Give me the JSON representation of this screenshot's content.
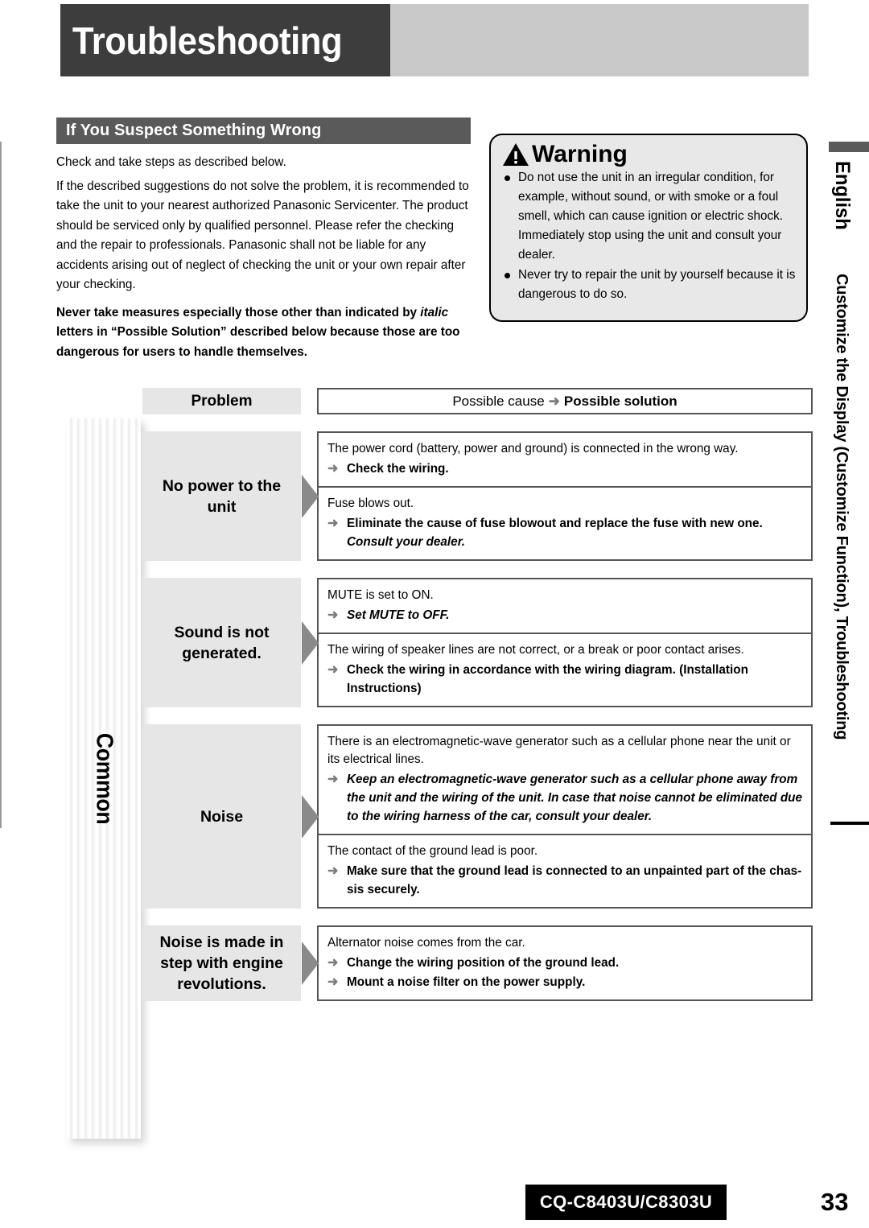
{
  "header": {
    "title": "Troubleshooting"
  },
  "section": {
    "heading": "If You Suspect Something Wrong",
    "paragraphs": [
      "Check and take steps as described below.",
      "If the described suggestions do not solve the problem, it is recommended to take the unit to your nearest authorized Panasonic Servicenter. The product should be serviced only by qualified personnel. Please refer the checking and the repair to professionals. Panasonic shall not be liable for any accidents arising out of neglect of checking the unit or your own repair after your checking."
    ],
    "bold_note_part1": "Never take measures especially those other than indicated by ",
    "bold_note_italic": "italic",
    "bold_note_part2": " letters in “Possible Solution” described below because those are too dangerous for users to handle themselves."
  },
  "warning": {
    "title": "Warning",
    "icon": "warning-triangle-icon",
    "items": [
      "Do not use the unit in an irregular condition, for example, without sound, or with smoke or a foul smell, which can cause ignition or electric shock. Immediately stop using the unit and consult your dealer.",
      "Never try to repair the unit by yourself because it is dangerous to do so."
    ]
  },
  "sidebar": {
    "language": "English",
    "chapter": "Customize the Display (Customize Function), Troubleshooting"
  },
  "section_tab": {
    "label": "Common"
  },
  "table": {
    "header": {
      "problem": "Problem",
      "cause_label": "Possible cause",
      "arrow": "arrow-right-icon",
      "solution_label": "Possible solution"
    },
    "rows": [
      {
        "problem": "No power to the unit",
        "cells": [
          {
            "cause": "The power cord (battery, power and ground) is connected in the wrong way.",
            "solutions": [
              {
                "text": "Check the wiring.",
                "italic": false
              }
            ]
          },
          {
            "cause": "Fuse blows out.",
            "solutions": [
              {
                "text": "Eliminate the cause of fuse blowout and replace the fuse with new one. ",
                "trailing_italic": "Consult your dealer.",
                "italic": false
              }
            ]
          }
        ]
      },
      {
        "problem": "Sound is not generated.",
        "cells": [
          {
            "cause": "MUTE is set to ON.",
            "solutions": [
              {
                "text": "Set MUTE to OFF.",
                "italic": true
              }
            ]
          },
          {
            "cause": "The wiring of speaker lines are not correct, or a break or poor contact arises.",
            "solutions": [
              {
                "text": "Check the wiring in accordance with the wiring diagram. (Installation Instructions)",
                "italic": false
              }
            ]
          }
        ]
      },
      {
        "problem": "Noise",
        "cells": [
          {
            "cause": "There is an electromagnetic-wave generator such as a cellular phone near the unit or its electrical lines.",
            "solutions": [
              {
                "text": "Keep an electromagnetic-wave generator such as a cellular phone away from the unit and the wiring of the unit. In case that noise cannot be eliminated due to the wiring harness of the car, consult your dealer.",
                "italic": true
              }
            ]
          },
          {
            "cause": "The contact of the ground lead is poor.",
            "solutions": [
              {
                "text": "Make sure that the ground lead is connected to an unpainted part of the chas-sis securely.",
                "italic": false
              }
            ]
          }
        ]
      },
      {
        "problem": "Noise is made in step with engine revolutions.",
        "cells": [
          {
            "cause": "Alternator noise comes from the car.",
            "solutions": [
              {
                "text": "Change the wiring position of the ground lead.",
                "italic": false
              },
              {
                "text": "Mount a noise filter on the power supply.",
                "italic": false
              }
            ]
          }
        ]
      }
    ]
  },
  "footer": {
    "model": "CQ-C8403U/C8303U",
    "page_number": "33"
  },
  "colors": {
    "title_block": "#3d3d3d",
    "title_extension": "#cccccc",
    "section_bar": "#5a5a5a",
    "problem_cell": "#e6e6e6",
    "warning_bg": "#e8e8e8",
    "arrow_gray": "#8a8a8a"
  }
}
